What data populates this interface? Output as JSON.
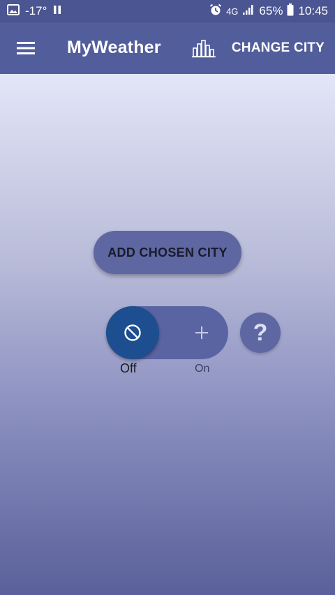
{
  "status_bar": {
    "temperature": "-17°",
    "network": "4G",
    "battery_percent": "65%",
    "time": "10:45"
  },
  "app_bar": {
    "title": "MyWeather",
    "change_city_label": "CHANGE CITY"
  },
  "main": {
    "add_city_label": "ADD CHOSEN CITY",
    "toggle": {
      "off_label": "Off",
      "on_label": "On",
      "state": "Off"
    },
    "help_label": "?"
  },
  "colors": {
    "status_bar": "#4a5591",
    "app_bar": "#525e9b",
    "button": "#5e67a2",
    "toggle_knob": "#1d4e8f"
  },
  "icons": {
    "status_left": [
      "image-icon",
      "pause-icon"
    ],
    "status_right": [
      "alarm-icon",
      "signal-icon",
      "battery-icon"
    ],
    "app_bar": [
      "menu-icon",
      "city-chart-icon"
    ],
    "toggle": [
      "block-icon",
      "plus-icon"
    ]
  }
}
